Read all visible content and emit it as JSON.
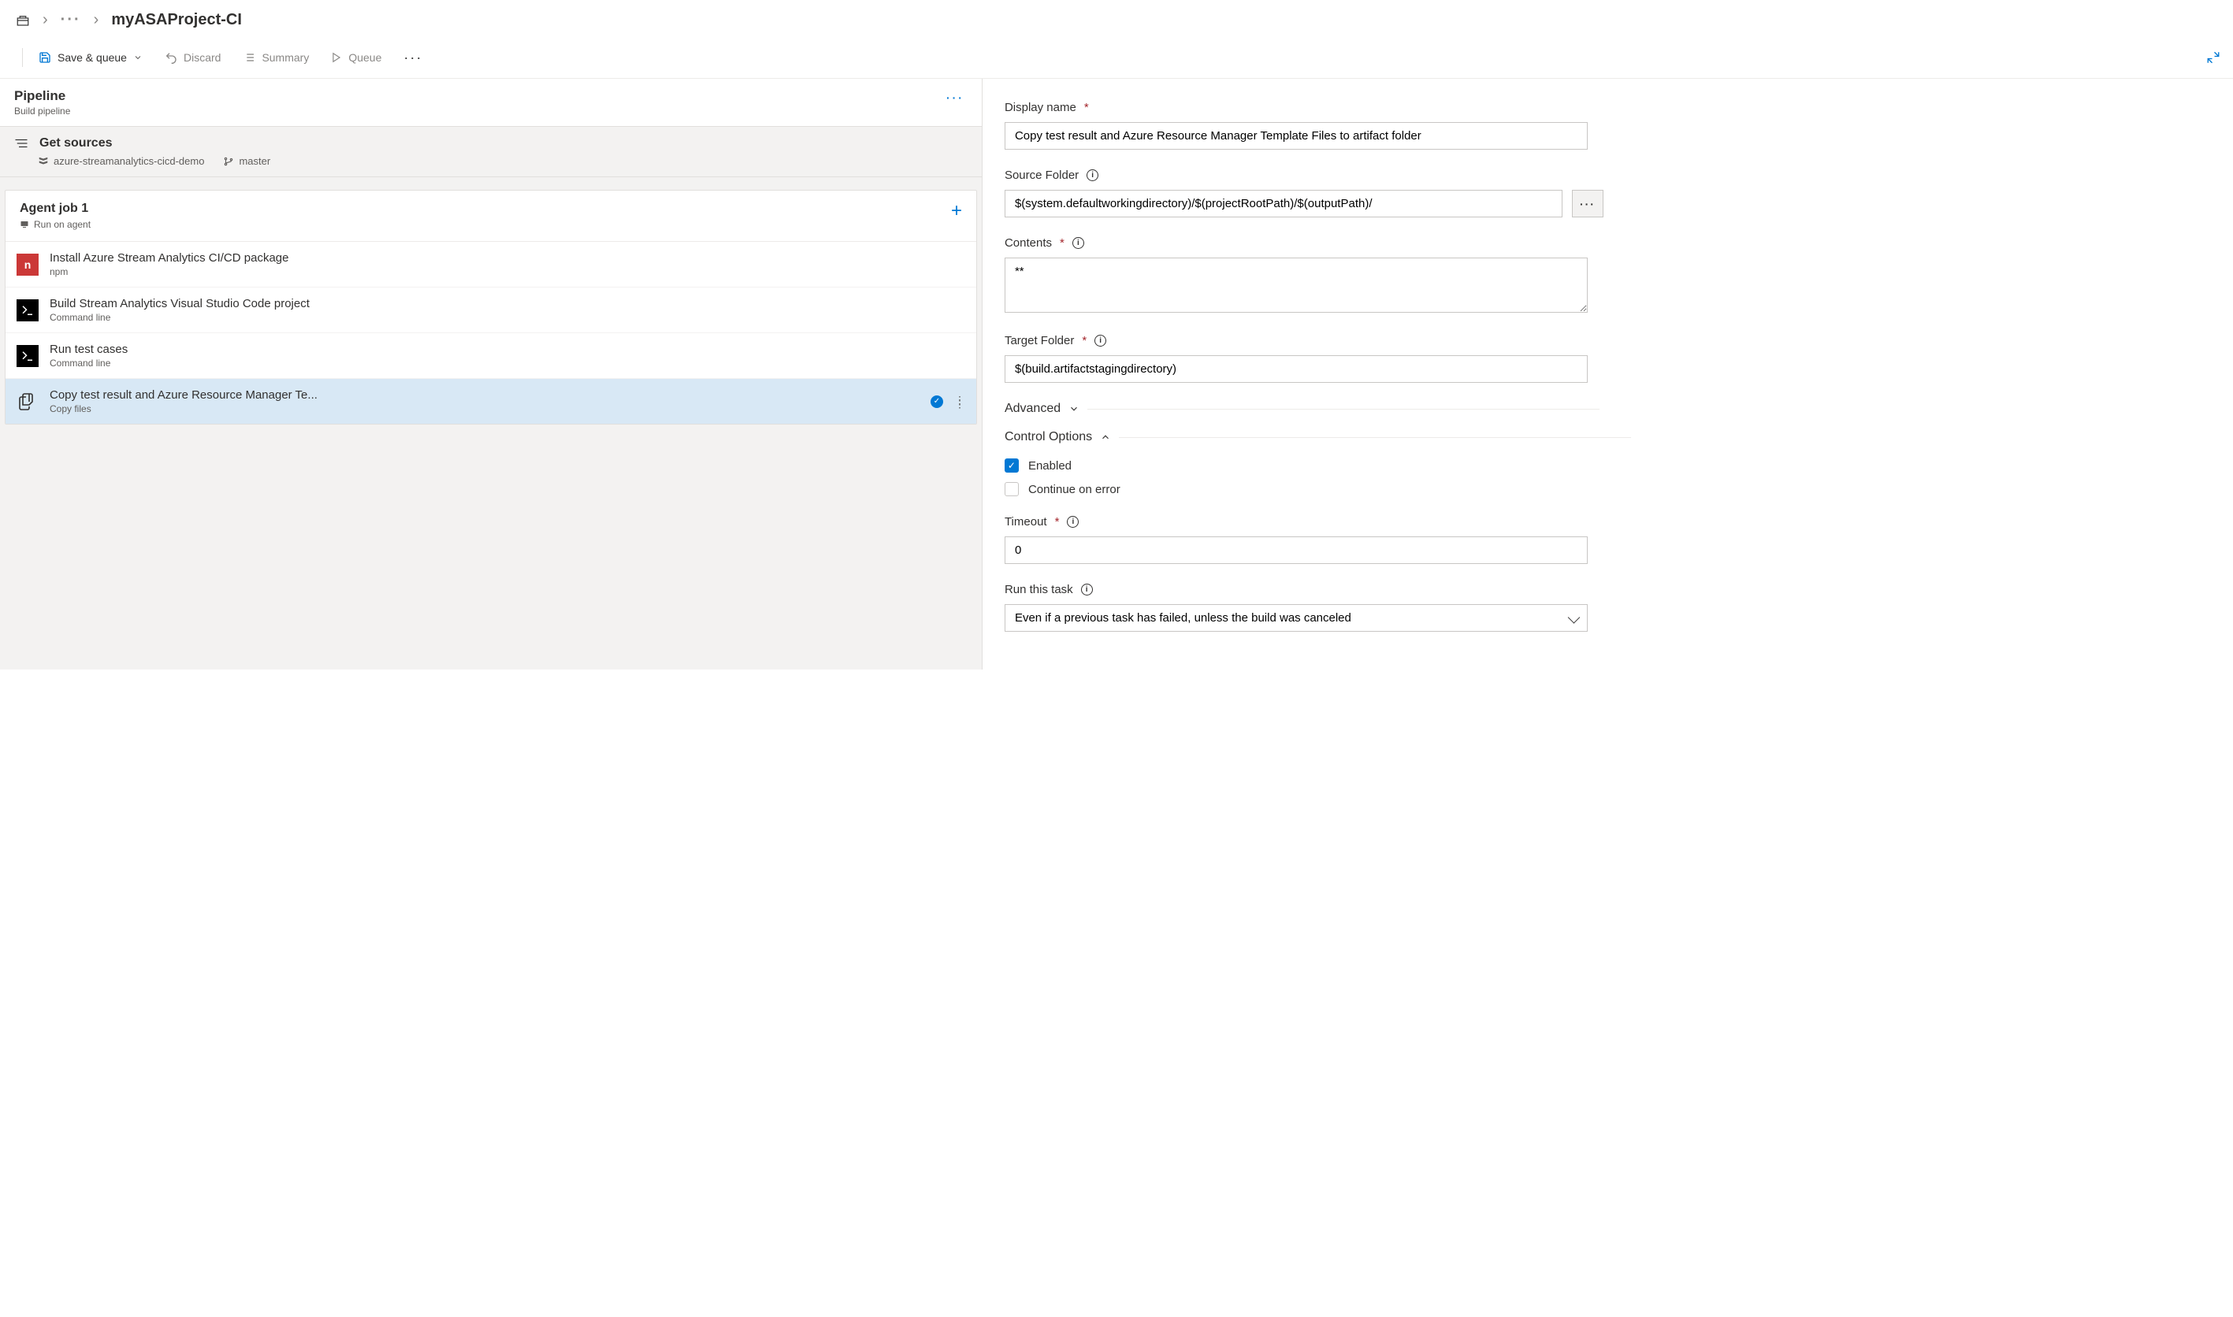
{
  "breadcrumb": {
    "project": "myASAProject-CI"
  },
  "toolbar": {
    "save": "Save & queue",
    "discard": "Discard",
    "summary": "Summary",
    "queue": "Queue"
  },
  "pipeline": {
    "title": "Pipeline",
    "subtitle": "Build pipeline",
    "getSources": {
      "title": "Get sources",
      "repo": "azure-streamanalytics-cicd-demo",
      "branch": "master"
    },
    "job": {
      "title": "Agent job 1",
      "subtitle": "Run on agent"
    },
    "tasks": [
      {
        "title": "Install Azure Stream Analytics CI/CD package",
        "sub": "npm",
        "kind": "npm"
      },
      {
        "title": "Build Stream Analytics Visual Studio Code project",
        "sub": "Command line",
        "kind": "cmd"
      },
      {
        "title": "Run test cases",
        "sub": "Command line",
        "kind": "cmd"
      },
      {
        "title": "Copy test result and Azure Resource Manager Te...",
        "sub": "Copy files",
        "kind": "copy",
        "selected": true
      }
    ]
  },
  "form": {
    "displayName": {
      "label": "Display name",
      "value": "Copy test result and Azure Resource Manager Template Files to artifact folder"
    },
    "sourceFolder": {
      "label": "Source Folder",
      "value": "$(system.defaultworkingdirectory)/$(projectRootPath)/$(outputPath)/"
    },
    "contents": {
      "label": "Contents",
      "value": "**"
    },
    "targetFolder": {
      "label": "Target Folder",
      "value": "$(build.artifactstagingdirectory)"
    },
    "advanced": "Advanced",
    "controlOptions": "Control Options",
    "enabled": "Enabled",
    "continueOnError": "Continue on error",
    "timeout": {
      "label": "Timeout",
      "value": "0"
    },
    "runThisTask": {
      "label": "Run this task",
      "value": "Even if a previous task has failed, unless the build was canceled"
    }
  }
}
